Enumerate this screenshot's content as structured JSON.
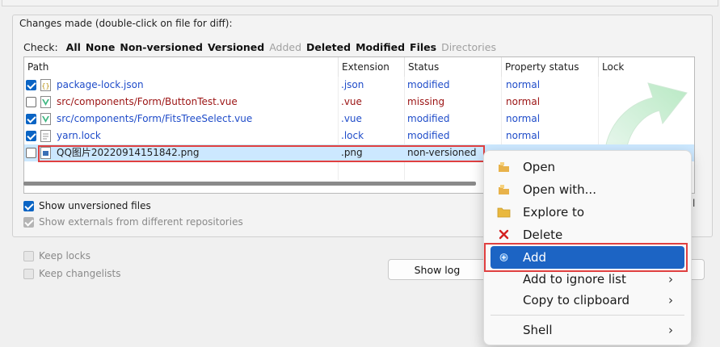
{
  "group": {
    "label": "Changes made (double-click on file for diff):"
  },
  "check": {
    "label": "Check:",
    "links": [
      {
        "text": "All",
        "enabled": true
      },
      {
        "text": "None",
        "enabled": true
      },
      {
        "text": "Non-versioned",
        "enabled": true
      },
      {
        "text": "Versioned",
        "enabled": true
      },
      {
        "text": "Added",
        "enabled": false
      },
      {
        "text": "Deleted",
        "enabled": true
      },
      {
        "text": "Modified",
        "enabled": true
      },
      {
        "text": "Files",
        "enabled": true
      },
      {
        "text": "Directories",
        "enabled": false
      }
    ]
  },
  "table": {
    "columns": [
      "Path",
      "Extension",
      "Status",
      "Property status",
      "Lock"
    ],
    "rows": [
      {
        "checked": true,
        "icon": "json-file-icon",
        "path": "package-lock.json",
        "ext": ".json",
        "status": "modified",
        "prop": "normal",
        "color": "blue"
      },
      {
        "checked": false,
        "icon": "vue-file-icon",
        "path": "src/components/Form/ButtonTest.vue",
        "ext": ".vue",
        "status": "missing",
        "prop": "normal",
        "color": "red"
      },
      {
        "checked": true,
        "icon": "vue-file-icon",
        "path": "src/components/Form/FitsTreeSelect.vue",
        "ext": ".vue",
        "status": "modified",
        "prop": "normal",
        "color": "blue"
      },
      {
        "checked": true,
        "icon": "text-file-icon",
        "path": "yarn.lock",
        "ext": ".lock",
        "status": "modified",
        "prop": "normal",
        "color": "blue"
      },
      {
        "checked": false,
        "icon": "image-file-icon",
        "path": "QQ图片20220914151842.png",
        "ext": ".png",
        "status": "non-versioned",
        "prop": "",
        "color": "dark"
      }
    ]
  },
  "options": {
    "show_unversioned": "Show unversioned files",
    "show_externals": "Show externals from different repositories",
    "keep_locks": "Keep locks",
    "keep_changelists": "Keep changelists"
  },
  "total_fragment": "tal",
  "buttons": {
    "show_log": "Show log"
  },
  "context_menu": {
    "items": [
      {
        "label": "Open",
        "icon": "open-icon"
      },
      {
        "label": "Open with...",
        "icon": "open-with-icon"
      },
      {
        "label": "Explore to",
        "icon": "folder-icon"
      },
      {
        "label": "Delete",
        "icon": "delete-x-icon"
      },
      {
        "label": "Add",
        "icon": "add-icon",
        "active": true
      },
      {
        "label": "Add to ignore list",
        "submenu": true
      },
      {
        "label": "Copy to clipboard",
        "submenu": true
      },
      {
        "label": "Shell",
        "submenu": true
      }
    ]
  },
  "colors": {
    "accent": "#1c64c4",
    "highlight_box": "#e04040",
    "selected_row": "#cce8ff",
    "modified_text": "#1f4cc9",
    "missing_text": "#9b1313"
  }
}
